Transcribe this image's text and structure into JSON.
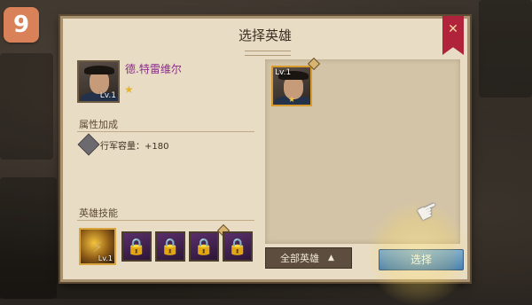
{
  "step_badge": "9",
  "dialog": {
    "title": "选择英雄",
    "close_icon": "crossed-swords-ribbon-icon"
  },
  "hero": {
    "name": "德.特雷维尔",
    "level": "Lv.1",
    "stars": "★"
  },
  "attributes": {
    "section_label": "属性加成",
    "stat_label": "行军容量：+180",
    "stat_icon": "march-capacity-icon"
  },
  "skills": {
    "section_label": "英雄技能",
    "active_level": "Lv.1",
    "locked_icon": "padlock-icon",
    "count": 5
  },
  "hero_list": [
    {
      "level": "Lv.1",
      "stars": "★",
      "selected": true
    }
  ],
  "filter": {
    "label": "全部英雄",
    "caret": "▲"
  },
  "select_button": "选择",
  "colors": {
    "accent_name": "#8a2c8c",
    "select_button": "#3577bb",
    "ribbon": "#b0233a",
    "step_badge": "#d9825a"
  }
}
